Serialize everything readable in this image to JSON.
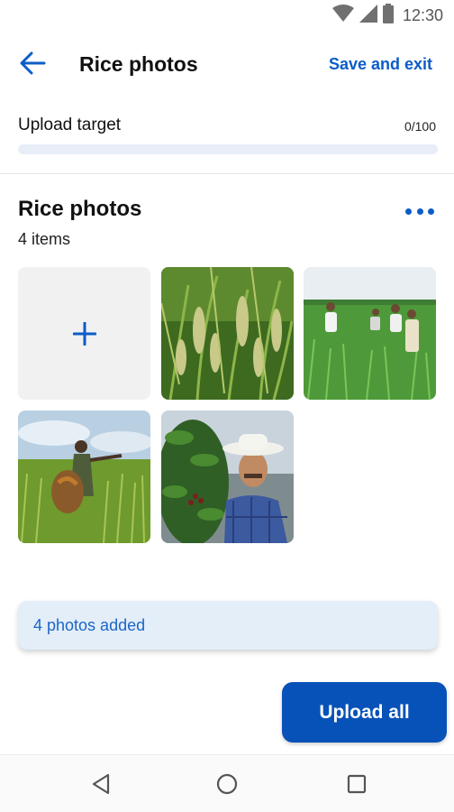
{
  "status_bar": {
    "time": "12:30",
    "icons": [
      "wifi-icon",
      "signal-icon",
      "battery-icon"
    ]
  },
  "app_bar": {
    "back_icon": "arrow-left-icon",
    "title": "Rice photos",
    "save_label": "Save and exit"
  },
  "upload_target": {
    "label": "Upload target",
    "count_text": "0/100",
    "progress_fraction": 0
  },
  "album": {
    "title": "Rice photos",
    "count_text": "4 items",
    "more_icon": "more-horizontal-icon",
    "add_icon": "plus-icon",
    "photos": [
      "rice-panicles-photo",
      "farmers-in-field-photo",
      "farmer-pointing-photo",
      "farmer-with-hat-photo"
    ]
  },
  "snackbar": {
    "text": "4 photos added"
  },
  "primary_action": {
    "label": "Upload all"
  },
  "nav": {
    "back_icon": "nav-back-icon",
    "home_icon": "nav-home-icon",
    "recents_icon": "nav-recents-icon"
  },
  "colors": {
    "accent": "#0b5cc7",
    "button": "#0752b8",
    "snackbar_bg": "#e3eef9",
    "progress_track": "#e7eef8"
  }
}
